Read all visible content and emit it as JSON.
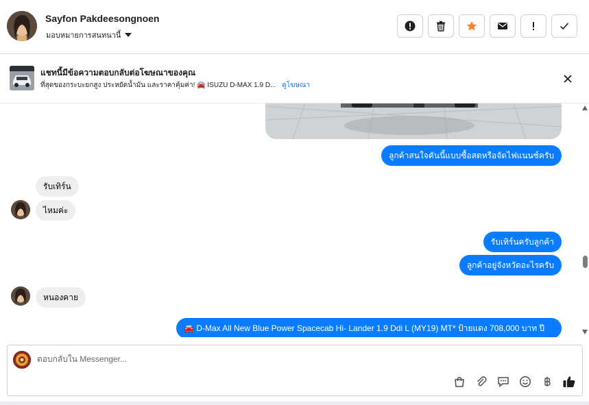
{
  "header": {
    "contact_name": "Sayfon Pakdeesongnoen",
    "assign_label": "มอบหมายการสนทนานี้",
    "actions": [
      {
        "name": "report-spam-button",
        "icon": "alert-circle-icon"
      },
      {
        "name": "delete-button",
        "icon": "trash-icon"
      },
      {
        "name": "star-button",
        "icon": "star-icon"
      },
      {
        "name": "mark-unread-button",
        "icon": "envelope-icon"
      },
      {
        "name": "important-button",
        "icon": "exclamation-icon"
      },
      {
        "name": "mark-done-button",
        "icon": "check-icon"
      }
    ]
  },
  "ad_banner": {
    "title": "แชทนี้มีข้อความตอบกลับต่อโฆษณาของคุณ",
    "description": "ที่สุดของกระบะยกสูง ประหยัดน้ำมัน และราคาคุ้มค่า! 🚘 ISUZU D-MAX 1.9 D...",
    "link_label": "ดูโฆษณา"
  },
  "messages": [
    {
      "direction": "out",
      "text": "ลูกค้าสนใจคันนี้แบบซื้อสดหรือจัดไฟแนนซ์ครับ"
    },
    {
      "direction": "in",
      "text": "รับเทิร์น"
    },
    {
      "direction": "in",
      "text": "ไหมค่ะ"
    },
    {
      "direction": "out",
      "text": "รับเทิร์นครับลูกค้า"
    },
    {
      "direction": "out",
      "text": "ลูกค้าอยู่จังหวัดอะไรครับ"
    },
    {
      "direction": "in",
      "text": "หนองคาย"
    },
    {
      "direction": "out",
      "text": "🚘 D-Max All New Blue Power Spacecab Hi- Lander 1.9 Ddi L (MY19) MT* ป้ายแดง 708,000 บาท ปี"
    }
  ],
  "composer": {
    "placeholder": "ตอบกลับใน Messenger...",
    "tools": [
      "shopping-bag-icon",
      "paperclip-icon",
      "saved-reply-icon",
      "emoji-icon",
      "baht-icon",
      "thumbs-up-icon"
    ]
  },
  "colors": {
    "outgoing_bubble": "#0a7cff",
    "incoming_bubble": "#eeeeee",
    "accent_star": "#f5812f",
    "link": "#1a73e8"
  }
}
